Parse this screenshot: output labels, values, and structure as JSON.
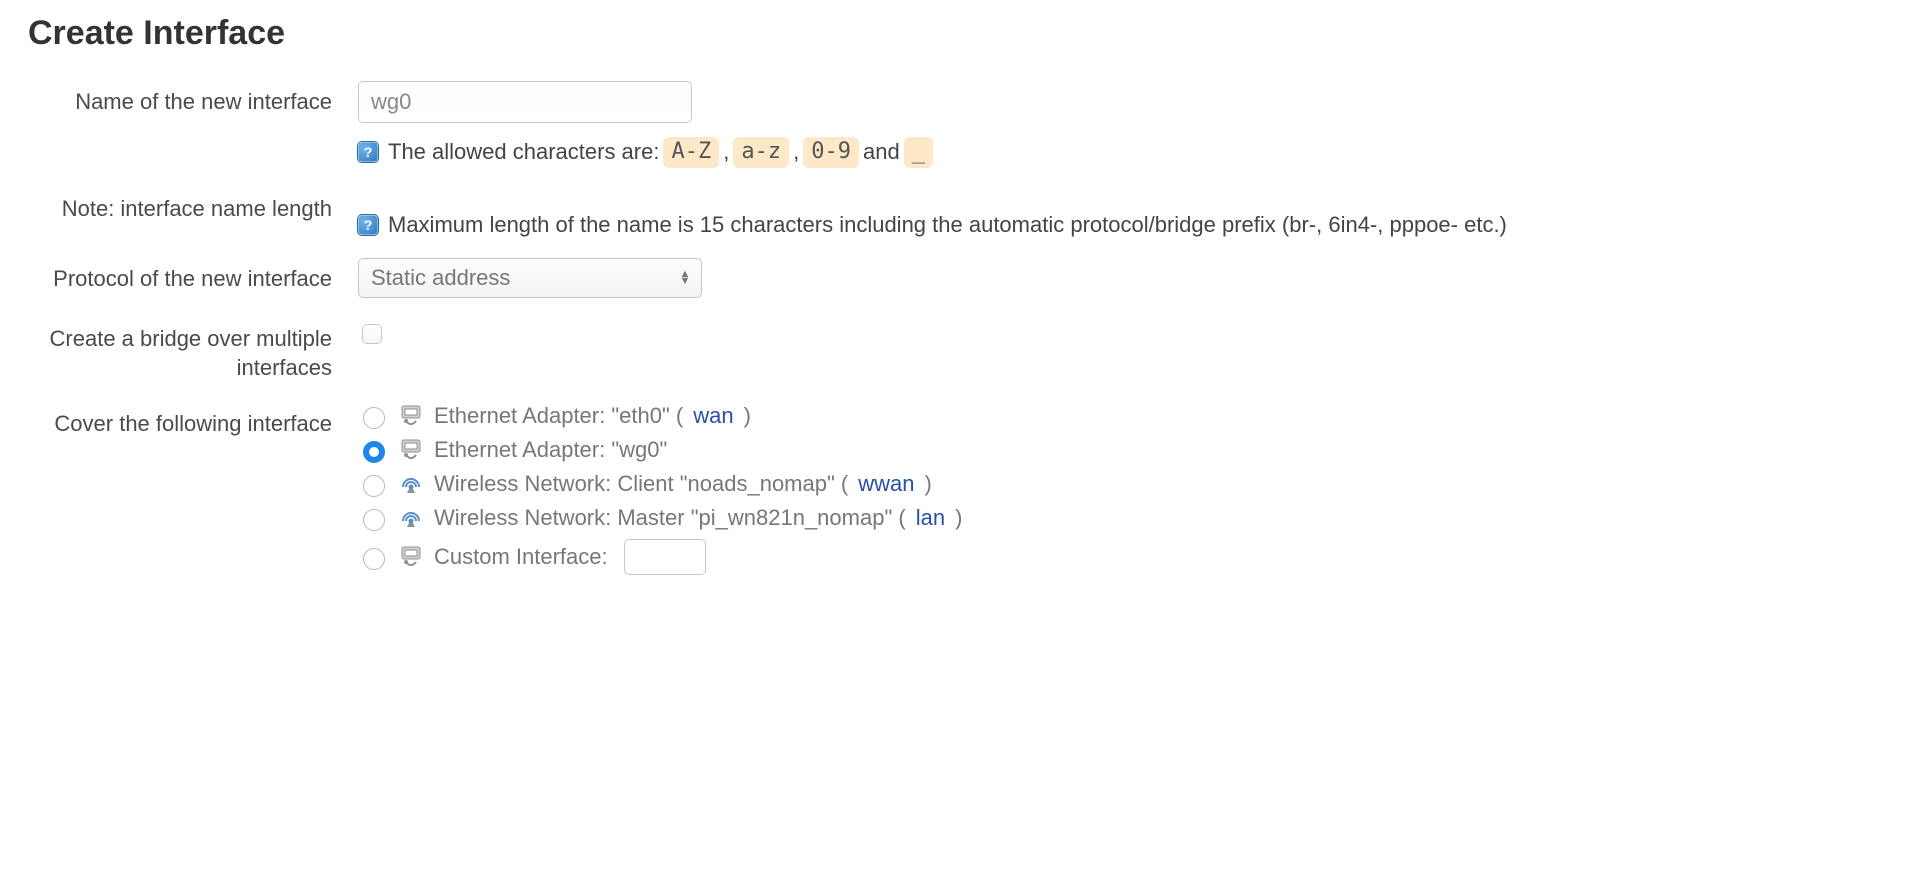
{
  "title": "Create Interface",
  "labels": {
    "name": "Name of the new interface",
    "note": "Note: interface name length",
    "protocol": "Protocol of the new interface",
    "bridge": "Create a bridge over multiple interfaces",
    "cover": "Cover the following interface"
  },
  "name_field": {
    "value": "wg0",
    "hint_prefix": "The allowed characters are:",
    "chips": [
      "A-Z",
      "a-z",
      "0-9"
    ],
    "hint_mid": ",",
    "hint_and": "and",
    "chip_last": "_"
  },
  "note_hint": "Maximum length of the name is 15 characters including the automatic protocol/bridge prefix (br-, 6in4-, pppoe- etc.)",
  "protocol_select": {
    "value": "Static address"
  },
  "bridge_checked": false,
  "cover_options": [
    {
      "label_prefix": "Ethernet Adapter: \"eth0\" (",
      "net": "wan",
      "label_suffix": ")",
      "icon": "ethernet",
      "checked": false
    },
    {
      "label_prefix": "Ethernet Adapter: \"wg0\"",
      "net": "",
      "label_suffix": "",
      "icon": "ethernet",
      "checked": true
    },
    {
      "label_prefix": "Wireless Network: Client \"noads_nomap\" (",
      "net": "wwan",
      "label_suffix": ")",
      "icon": "wireless",
      "checked": false
    },
    {
      "label_prefix": "Wireless Network: Master \"pi_wn821n_nomap\" (",
      "net": "lan",
      "label_suffix": ")",
      "icon": "wireless",
      "checked": false
    },
    {
      "label_prefix": "Custom Interface:",
      "net": "",
      "label_suffix": "",
      "icon": "ethernet",
      "checked": false,
      "custom": true
    }
  ]
}
